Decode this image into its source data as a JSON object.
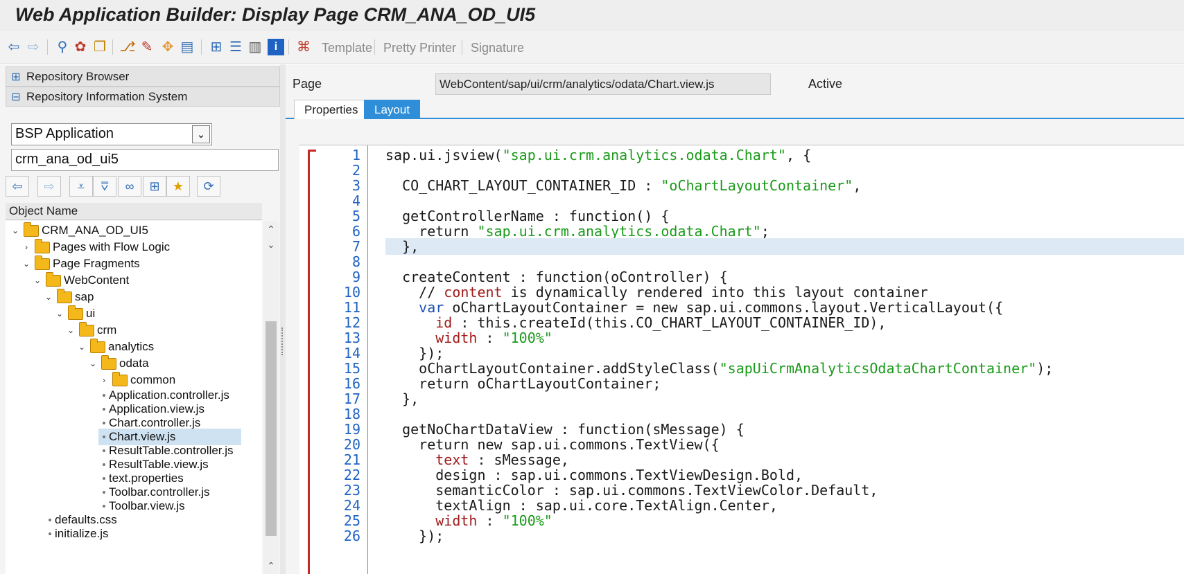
{
  "window": {
    "title": "Web Application Builder: Display Page CRM_ANA_OD_UI5"
  },
  "toolbar": {
    "icons": [
      "back-icon",
      "forward-icon",
      "glasses-icon",
      "switch-icon",
      "clipboard-icon",
      "hierarchy-icon",
      "magic-wand-icon",
      "move-icon",
      "display-icon",
      "org-chart-icon",
      "stack-icon",
      "list-icon",
      "info-icon",
      "pattern-icon"
    ],
    "template_label": "Template",
    "pretty_printer_label": "Pretty Printer",
    "signature_label": "Signature"
  },
  "nav": {
    "repository_browser": "Repository Browser",
    "repository_info_system": "Repository Information System",
    "object_type": "BSP Application",
    "object_name": "crm_ana_od_ui5"
  },
  "tree": {
    "header": "Object Name",
    "nodes": [
      {
        "label": "CRM_ANA_OD_UI5",
        "kind": "folder",
        "toggle": "⌄"
      },
      {
        "label": "Pages with Flow Logic",
        "kind": "folder",
        "toggle": "›"
      },
      {
        "label": "Page Fragments",
        "kind": "folder",
        "toggle": "⌄"
      },
      {
        "label": "WebContent",
        "kind": "folder",
        "toggle": "⌄"
      },
      {
        "label": "sap",
        "kind": "folder",
        "toggle": "⌄"
      },
      {
        "label": "ui",
        "kind": "folder",
        "toggle": "⌄"
      },
      {
        "label": "crm",
        "kind": "folder",
        "toggle": "⌄"
      },
      {
        "label": "analytics",
        "kind": "folder",
        "toggle": "⌄"
      },
      {
        "label": "odata",
        "kind": "folder",
        "toggle": "⌄"
      },
      {
        "label": "common",
        "kind": "folder",
        "toggle": "›"
      },
      {
        "label": "Application.controller.js",
        "kind": "file"
      },
      {
        "label": "Application.view.js",
        "kind": "file"
      },
      {
        "label": "Chart.controller.js",
        "kind": "file"
      },
      {
        "label": "Chart.view.js",
        "kind": "file",
        "selected": true
      },
      {
        "label": "ResultTable.controller.js",
        "kind": "file"
      },
      {
        "label": "ResultTable.view.js",
        "kind": "file"
      },
      {
        "label": "text.properties",
        "kind": "file"
      },
      {
        "label": "Toolbar.controller.js",
        "kind": "file"
      },
      {
        "label": "Toolbar.view.js",
        "kind": "file"
      },
      {
        "label": "defaults.css",
        "kind": "file"
      },
      {
        "label": "initialize.js",
        "kind": "file"
      }
    ]
  },
  "page": {
    "label": "Page",
    "path": "WebContent/sap/ui/crm/analytics/odata/Chart.view.js",
    "status": "Active"
  },
  "tabs": {
    "properties": "Properties",
    "layout": "Layout",
    "active": "Layout"
  },
  "code": {
    "highlight_line": 7,
    "lines": [
      "sap.ui.jsview(\"sap.ui.crm.analytics.odata.Chart\", {",
      "",
      "  CO_CHART_LAYOUT_CONTAINER_ID : \"oChartLayoutContainer\",",
      "",
      "  getControllerName : function() {",
      "    return \"sap.ui.crm.analytics.odata.Chart\";",
      "  },",
      "",
      "  createContent : function(oController) {",
      "    // content is dynamically rendered into this layout container",
      "    var oChartLayoutContainer = new sap.ui.commons.layout.VerticalLayout({",
      "      id : this.createId(this.CO_CHART_LAYOUT_CONTAINER_ID),",
      "      width : \"100%\"",
      "    });",
      "    oChartLayoutContainer.addStyleClass(\"sapUiCrmAnalyticsOdataChartContainer\");",
      "    return oChartLayoutContainer;",
      "  },",
      "",
      "  getNoChartDataView : function(sMessage) {",
      "    return new sap.ui.commons.TextView({",
      "      text : sMessage,",
      "      design : sap.ui.commons.TextViewDesign.Bold,",
      "      semanticColor : sap.ui.commons.TextViewColor.Default,",
      "      textAlign : sap.ui.core.TextAlign.Center,",
      "      width : \"100%\"",
      "    });"
    ]
  },
  "colors": {
    "accent": "#2f8ed8",
    "string": "#1a9a1a",
    "keyword": "#a01a1a",
    "line_number": "#1e62c4",
    "folder": "#f5b81a"
  }
}
